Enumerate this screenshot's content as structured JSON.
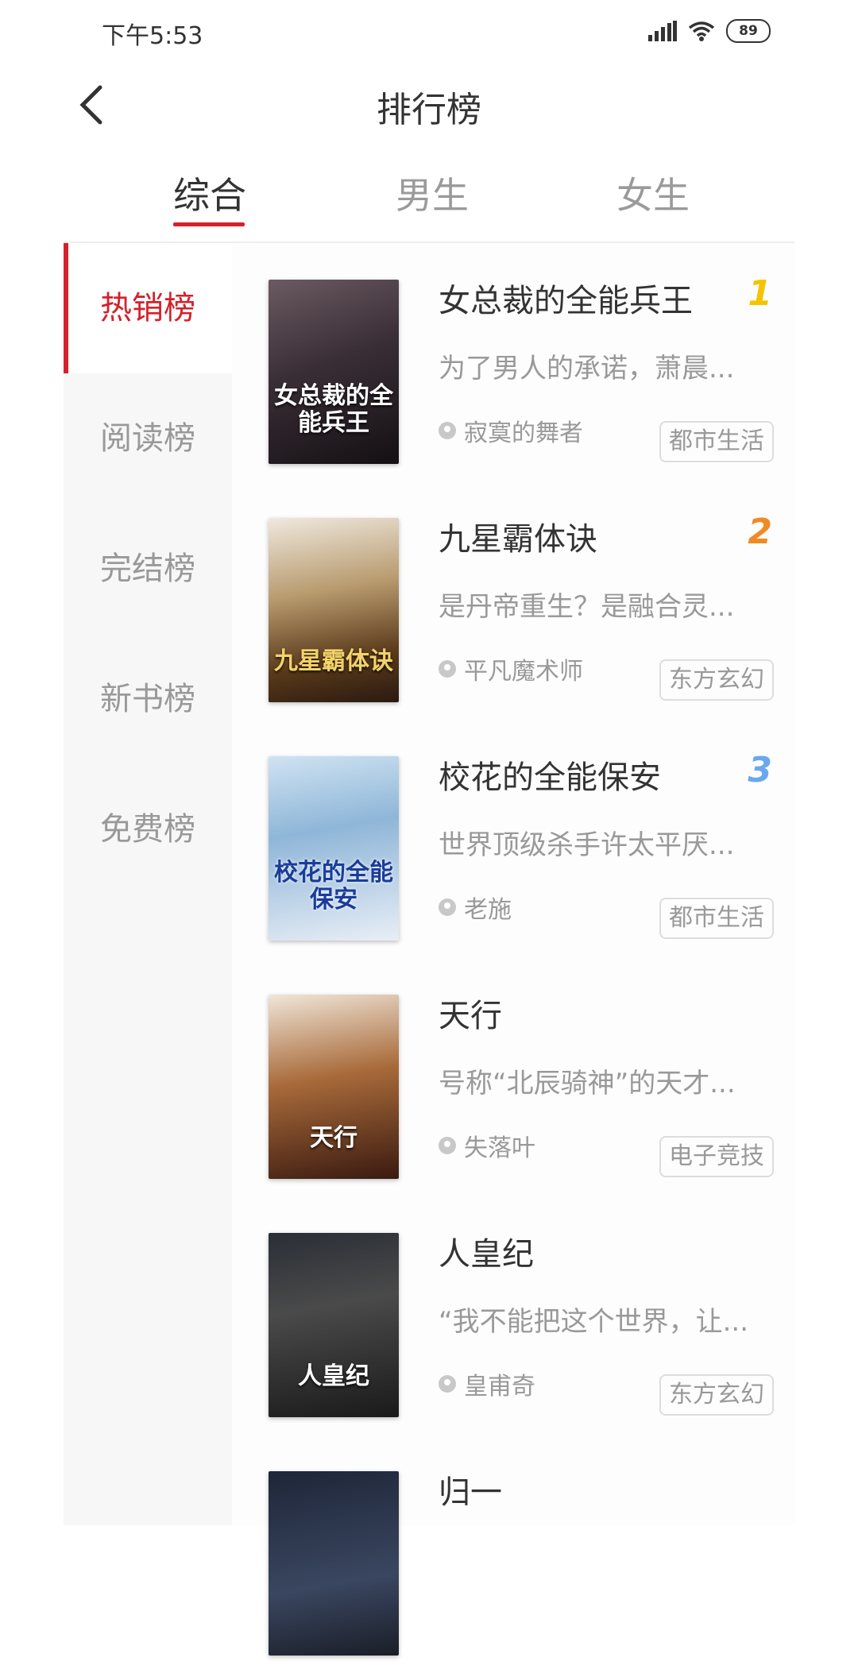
{
  "status_bar": {
    "time": "下午5:53",
    "battery": "89"
  },
  "header": {
    "title": "排行榜"
  },
  "tabs": [
    {
      "label": "综合",
      "active": true
    },
    {
      "label": "男生",
      "active": false
    },
    {
      "label": "女生",
      "active": false
    }
  ],
  "sidebar": {
    "items": [
      {
        "label": "热销榜",
        "active": true
      },
      {
        "label": "阅读榜",
        "active": false
      },
      {
        "label": "完结榜",
        "active": false
      },
      {
        "label": "新书榜",
        "active": false
      },
      {
        "label": "免费榜",
        "active": false
      }
    ]
  },
  "colors": {
    "accent": "#d4212b",
    "rank1": "#f5c400",
    "rank2": "#f08a24",
    "rank3": "#6aa8ee"
  },
  "books": [
    {
      "title": "女总裁的全能兵王",
      "rank": "1",
      "desc": "为了男人的承诺，萧晨...",
      "author": "寂寞的舞者",
      "tag": "都市生活",
      "cover_text": "女总裁的全能兵王"
    },
    {
      "title": "九星霸体诀",
      "rank": "2",
      "desc": "是丹帝重生？是融合灵...",
      "author": "平凡魔术师",
      "tag": "东方玄幻",
      "cover_text": "九星霸体诀"
    },
    {
      "title": "校花的全能保安",
      "rank": "3",
      "desc": "  世界顶级杀手许太平厌...",
      "author": "老施",
      "tag": "都市生活",
      "cover_text": "校花的全能保安"
    },
    {
      "title": "天行",
      "rank": "",
      "desc": "号称“北辰骑神”的天才...",
      "author": "失落叶",
      "tag": "电子竞技",
      "cover_text": "天行"
    },
    {
      "title": "人皇纪",
      "rank": "",
      "desc": "“我不能把这个世界，让...",
      "author": "皇甫奇",
      "tag": "东方玄幻",
      "cover_text": "人皇纪"
    },
    {
      "title": "归一",
      "rank": "",
      "desc": "",
      "author": "",
      "tag": "",
      "cover_text": ""
    }
  ]
}
